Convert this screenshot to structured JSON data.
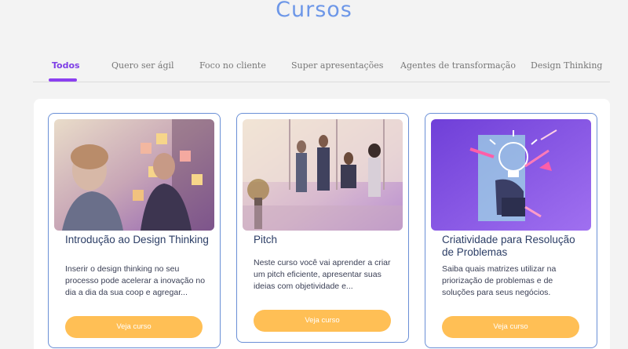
{
  "page": {
    "title": "Cursos"
  },
  "tabs": [
    {
      "label": "Todos",
      "active": true
    },
    {
      "label": "Quero ser ágil"
    },
    {
      "label": "Foco no cliente"
    },
    {
      "label": "Super apresentações"
    },
    {
      "label": "Agentes de transformação"
    },
    {
      "label": "Design Thinking"
    }
  ],
  "courses": [
    {
      "title": "Introdução ao Design Thinking",
      "description": "Inserir o design thinking no seu processo pode acelerar a inovação no dia a dia da sua coop e agregar...",
      "button": "Veja curso",
      "image": "people-with-sticky-notes-photo"
    },
    {
      "title": "Pitch",
      "description": "Neste curso você vai aprender a criar um pitch eficiente, apresentar suas ideias com objetividade e...",
      "button": "Veja curso",
      "image": "team-office-meeting-photo"
    },
    {
      "title": "Criatividade para Resolução de Problemas",
      "description": "Saiba quais matrizes utilizar na priorização de problemas e de soluções para seus negócios.",
      "button": "Veja curso",
      "image": "lightbulb-head-illustration"
    }
  ],
  "colors": {
    "accent": "#8b3ff0",
    "title": "#6d97e8",
    "button": "#ffbf55",
    "card_border": "#6a8fd6"
  }
}
